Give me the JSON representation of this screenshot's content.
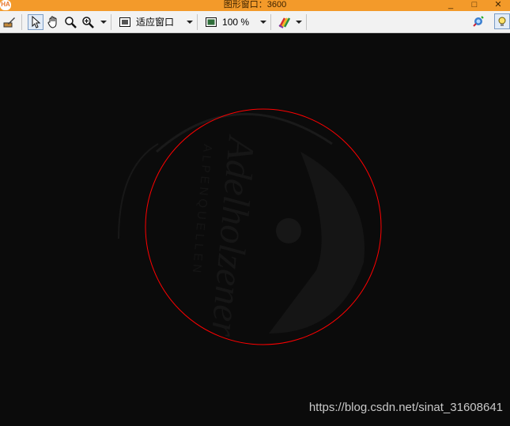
{
  "window": {
    "app_logo": "HA",
    "title": "图形窗口：3600",
    "minimize_glyph": "_",
    "maximize_glyph": "□",
    "close_glyph": "✕"
  },
  "toolbar": {
    "fit_mode_label": "适应窗口",
    "zoom_percent_label": "100 %",
    "icons": [
      "edit-icon",
      "pointer-icon",
      "hand-pan-icon",
      "zoom-icon",
      "zoom-in-icon",
      "fit-window-icon",
      "zoom-percent-icon",
      "color-palette-icon",
      "camera-icon",
      "lightbulb-icon"
    ]
  },
  "image_content": {
    "stamp_text_large": "Adelholzener",
    "stamp_text_small": "ALPENQUELLEN",
    "circle_color": "#ff0000"
  },
  "watermark": "https://blog.csdn.net/sinat_31608641"
}
